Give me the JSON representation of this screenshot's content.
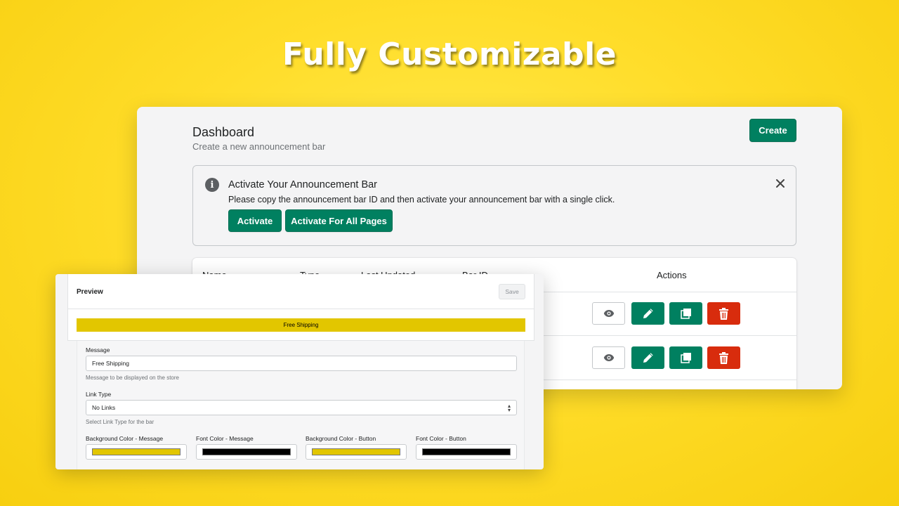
{
  "headline": "Fully Customizable",
  "colors": {
    "accent_green": "#008060",
    "danger_red": "#d82c0d",
    "bar_background": "#e2c600",
    "bar_font": "#000000",
    "button_background": "#e2c600",
    "button_font": "#000000"
  },
  "dashboard": {
    "title": "Dashboard",
    "subtitle": "Create a new announcement bar",
    "create_label": "Create",
    "banner": {
      "title": "Activate Your Announcement Bar",
      "text": "Please copy the announcement bar ID and then activate your announcement bar with a single click.",
      "activate_label": "Activate",
      "activate_all_label": "Activate For All Pages",
      "icon": "info-icon",
      "close_icon": "close-icon"
    },
    "table": {
      "headers": [
        "Name",
        "Type",
        "Last Updated",
        "Bar ID",
        "Actions"
      ],
      "row_actions": [
        "eye-icon",
        "pencil-icon",
        "duplicate-icon",
        "trash-icon"
      ]
    }
  },
  "preview": {
    "title": "Preview",
    "save_label": "Save",
    "bar_text": "Free Shipping",
    "form": {
      "message_label": "Message",
      "message_value": "Free Shipping",
      "message_help": "Message to be displayed on the store",
      "link_type_label": "Link Type",
      "link_type_value": "No Links",
      "link_type_help": "Select Link Type for the bar",
      "bg_message_label": "Background Color - Message",
      "font_message_label": "Font Color - Message",
      "bg_button_label": "Background Color - Button",
      "font_button_label": "Font Color - Button"
    }
  }
}
